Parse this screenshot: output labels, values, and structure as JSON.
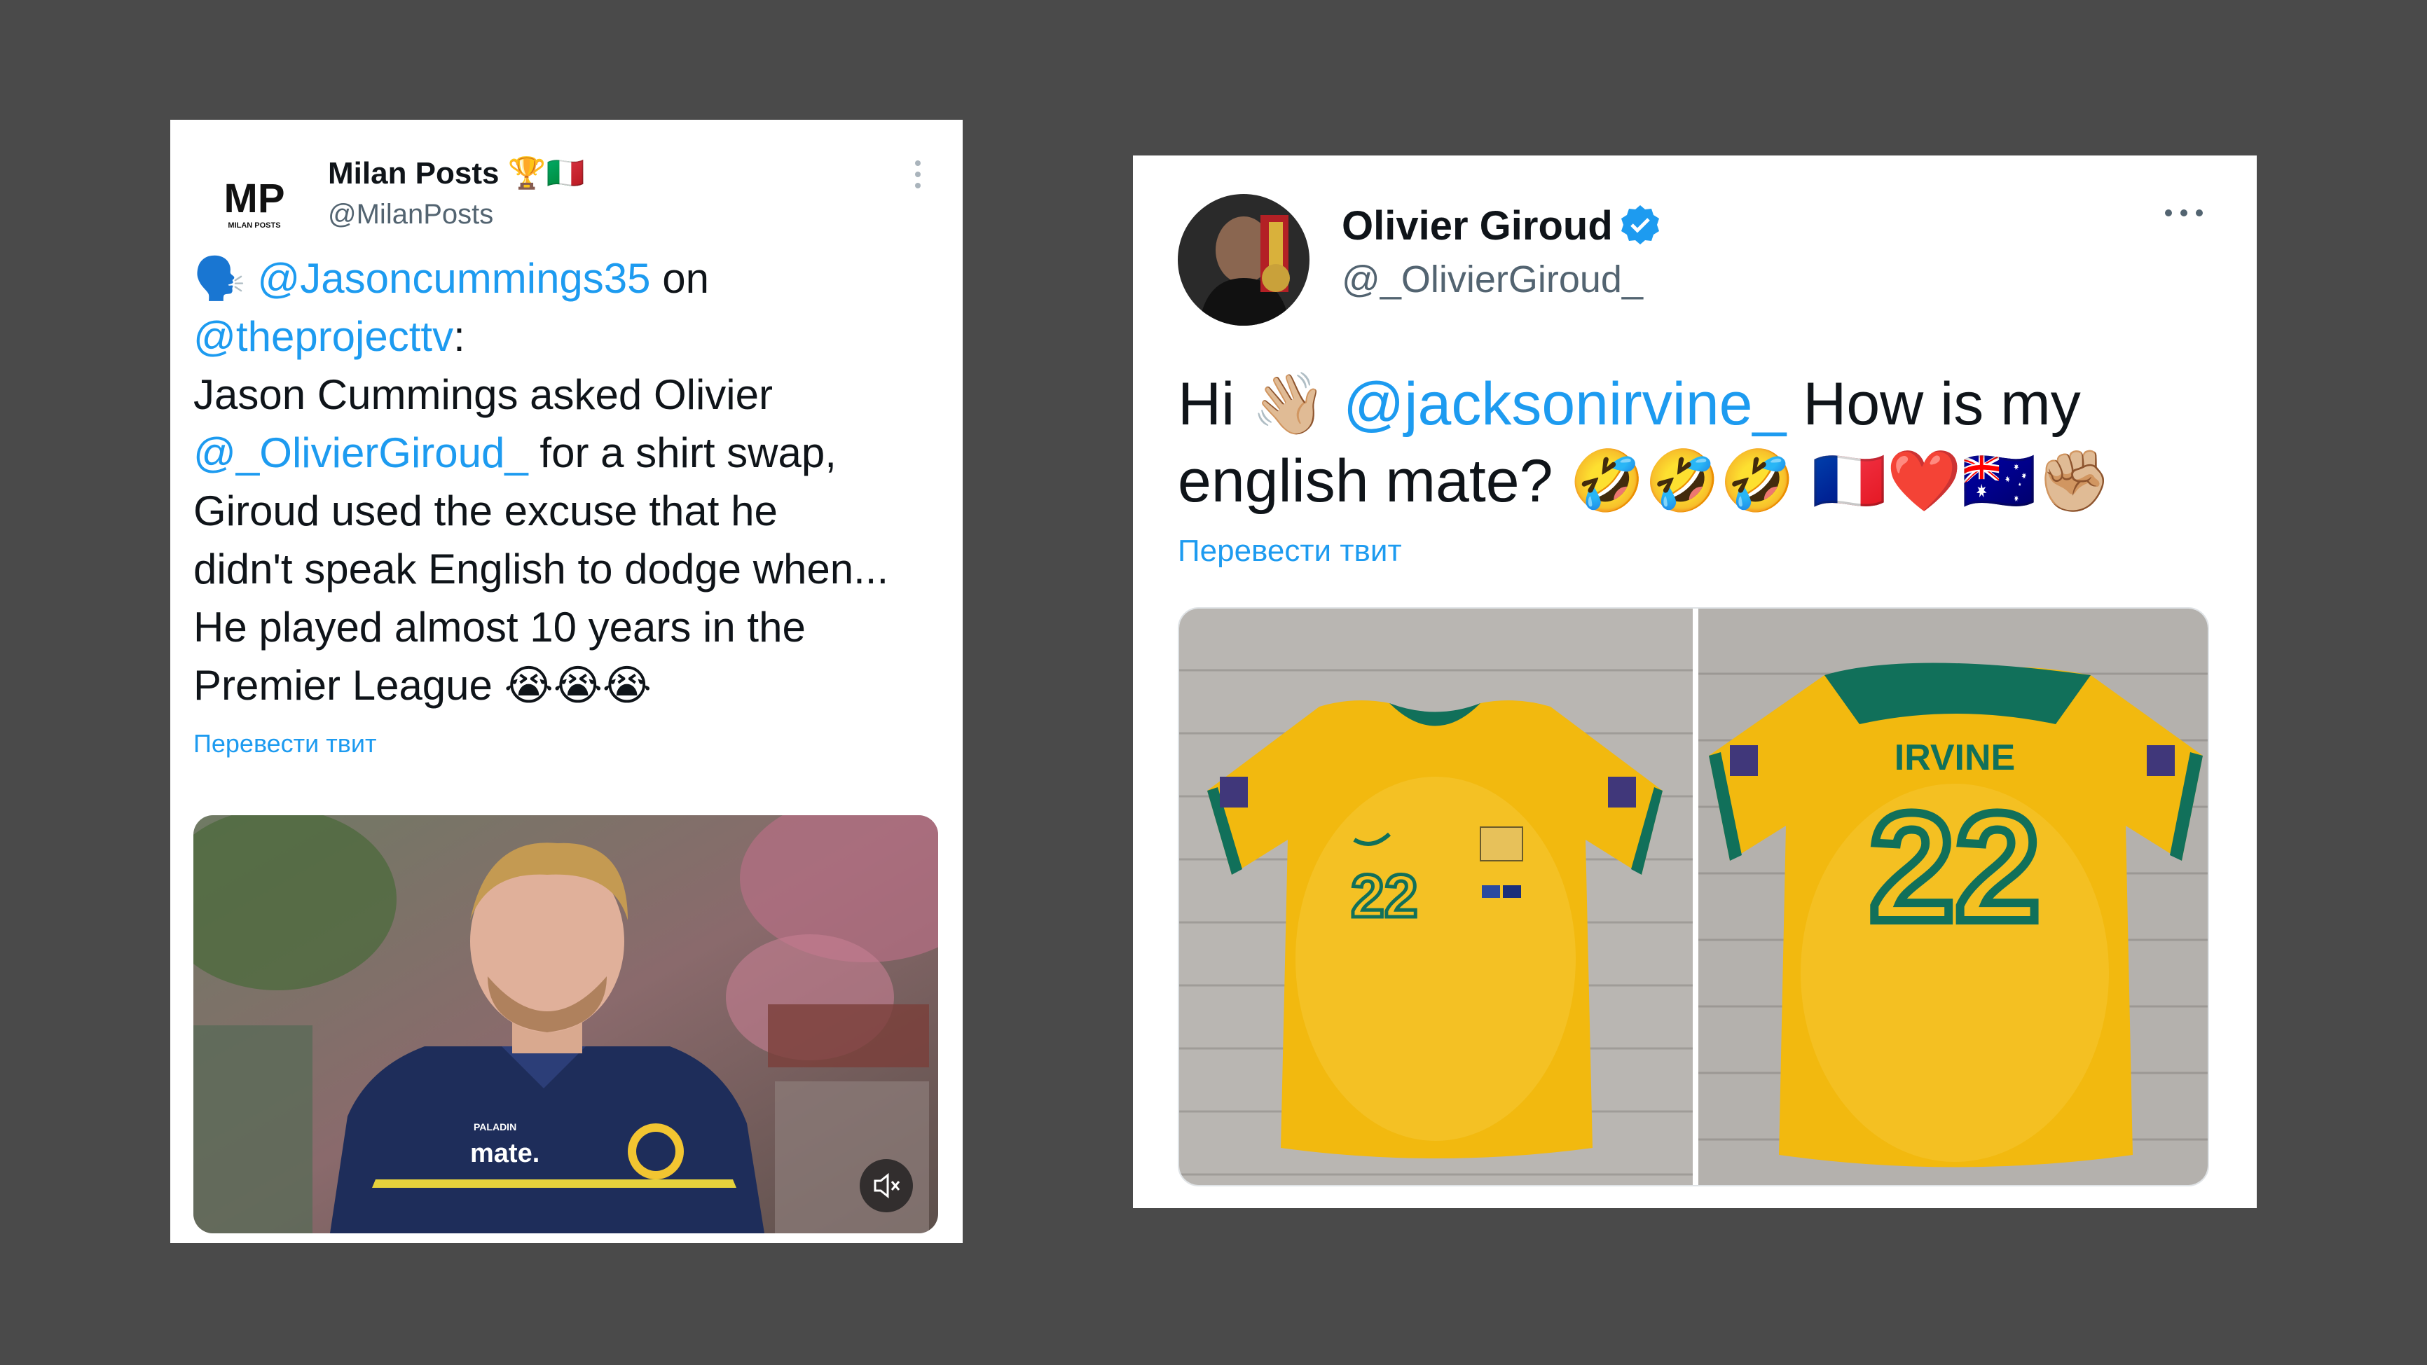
{
  "tweet_left": {
    "display_name": "Milan Posts",
    "name_emojis": "🏆🇮🇹",
    "handle": "@MilanPosts",
    "logo_text": "MP",
    "logo_subtext": "MILAN POSTS",
    "body": {
      "speaker_emoji": "🗣️",
      "mention_1": "@Jasoncummings35",
      "text_1": " on",
      "mention_2": "@theprojecttv",
      "text_2": ":",
      "line_1": "Jason Cummings asked Olivier",
      "mention_3": "@_OlivierGiroud_",
      "text_3": " for a shirt swap,",
      "line_2": "Giroud used the excuse that he",
      "line_3": "didn't speak English to dodge when...",
      "line_4": "He played almost 10 years in the",
      "line_5": "Premier League",
      "end_emojis": "😭😭😭"
    },
    "translate_label": "Перевести твит",
    "video": {
      "shirt_brand": "mate.",
      "shirt_sponsor": "PALADIN",
      "mute_icon": "speaker-muted-icon"
    }
  },
  "tweet_right": {
    "display_name": "Olivier Giroud",
    "handle": "@_OlivierGiroud_",
    "body": {
      "text_1": "Hi ",
      "wave_emoji": "👋🏼",
      "mention": "@jacksonirvine_",
      "text_2": " How is my",
      "line_2": "english mate?",
      "emojis": "🤣🤣🤣 🇫🇷❤️🇦🇺✊🏼"
    },
    "translate_label": "Перевести твит",
    "photos": {
      "back_name": "IRVINE",
      "number": "22"
    }
  },
  "colors": {
    "background": "#4a4a4a",
    "link": "#1d9bf0",
    "text": "#0f1419",
    "handle": "#536471",
    "jersey_yellow": "#f2b90f",
    "jersey_green": "#11705a"
  }
}
